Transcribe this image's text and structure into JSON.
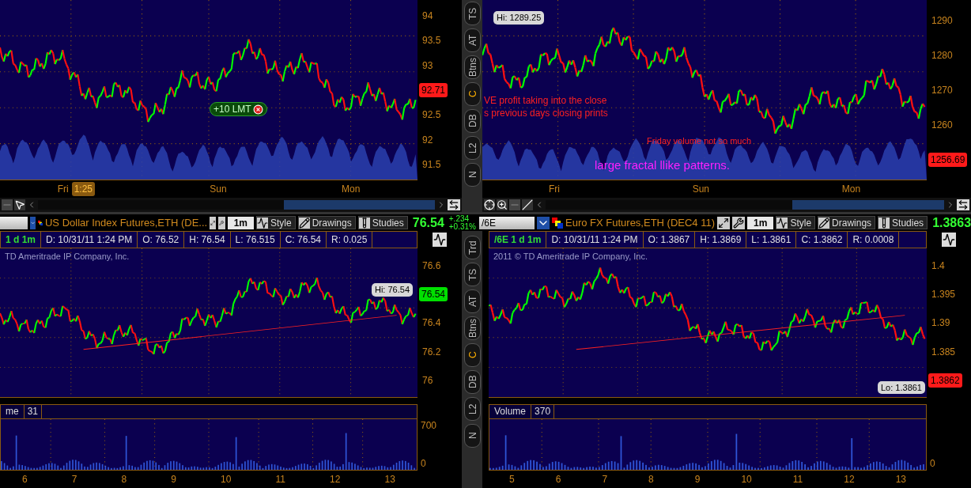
{
  "top_panels": [
    {
      "y_ticks": [
        "94",
        "93.5",
        "93",
        "92.5",
        "92",
        "91.5"
      ],
      "price_tag": {
        "text": "92.71",
        "color": "#ff1a1a"
      },
      "x_labels": [
        "Fri",
        "Sun",
        "Mon"
      ],
      "time_badge": "1:25",
      "order": "+10 LMT"
    },
    {
      "hi_label": "Hi: 1289.25",
      "y_ticks": [
        "1290",
        "1280",
        "1270",
        "1260"
      ],
      "price_tag": {
        "text": "1256.69",
        "color": "#ff1a1a"
      },
      "x_labels": [
        "Fri",
        "Sun",
        "Mon"
      ],
      "notes": [
        {
          "text": "VE profit taking into the close",
          "color": "#ff2020"
        },
        {
          "text": "s previous days closing prints",
          "color": "#ff2020"
        },
        {
          "text": "Friday volume not so much",
          "color": "#ff2020"
        },
        {
          "text": "large fractal llike patterns.",
          "color": "#ff20ff"
        }
      ]
    }
  ],
  "side_strips": [
    {
      "buttons": [
        {
          "label": "TS",
          "selected": false
        },
        {
          "label": "AT",
          "selected": false
        },
        {
          "label": "Btns",
          "selected": false
        },
        {
          "label": "C",
          "selected": true
        },
        {
          "label": "DB",
          "selected": false
        },
        {
          "label": "L2",
          "selected": false
        },
        {
          "label": "N",
          "selected": false
        }
      ]
    },
    {
      "buttons": [
        {
          "label": "Trd",
          "selected": false
        },
        {
          "label": "TS",
          "selected": false
        },
        {
          "label": "AT",
          "selected": false
        },
        {
          "label": "Btns",
          "selected": false
        },
        {
          "label": "C",
          "selected": true
        },
        {
          "label": "DB",
          "selected": false
        },
        {
          "label": "L2",
          "selected": false
        },
        {
          "label": "N",
          "selected": false
        }
      ]
    }
  ],
  "headers": [
    {
      "description": "US Dollar Index Futures,ETH (DE...",
      "interval": "1m",
      "buttons": [
        "Style",
        "Drawings",
        "Studies"
      ],
      "last": "76.54",
      "change": [
        "+.234",
        "+0.31%"
      ]
    },
    {
      "symbol": "/6E",
      "description": "Euro FX Futures,ETH (DEC4 11)",
      "interval": "1m",
      "buttons": [
        "Style",
        "Drawings",
        "Studies"
      ],
      "last": "1.3863"
    }
  ],
  "bottom_panels": [
    {
      "info": [
        "1 d 1m",
        "D: 10/31/11 1:24 PM",
        "O: 76.52",
        "H: 76.54",
        "L: 76.515",
        "C: 76.54",
        "R: 0.025"
      ],
      "copyright": "TD Ameritrade IP Company, Inc.",
      "extreme_label": "Hi: 76.54",
      "y_ticks": [
        "76.6",
        "76.4",
        "76.2",
        "76"
      ],
      "price_tag": {
        "text": "76.54",
        "color": "#00e000"
      },
      "volume_title": "me",
      "volume_value": "31",
      "volume_ticks": [
        "700",
        "0"
      ],
      "x_labels": [
        "6",
        "7",
        "8",
        "9",
        "10",
        "11",
        "12",
        "13"
      ]
    },
    {
      "info": [
        "/6E 1 d 1m",
        "D: 10/31/11 1:24 PM",
        "O: 1.3867",
        "H: 1.3869",
        "L: 1.3861",
        "C: 1.3862",
        "R: 0.0008"
      ],
      "copyright": "2011 © TD Ameritrade IP Company, Inc.",
      "extreme_label": "Lo: 1.3861",
      "y_ticks": [
        "1.4",
        "1.395",
        "1.39",
        "1.385"
      ],
      "price_tag": {
        "text": "1.3862",
        "color": "#ff1a1a"
      },
      "volume_title": "Volume",
      "volume_value": "370",
      "volume_ticks": [
        "0"
      ],
      "x_labels": [
        "5",
        "6",
        "7",
        "8",
        "9",
        "10",
        "11",
        "12",
        "13"
      ]
    }
  ]
}
